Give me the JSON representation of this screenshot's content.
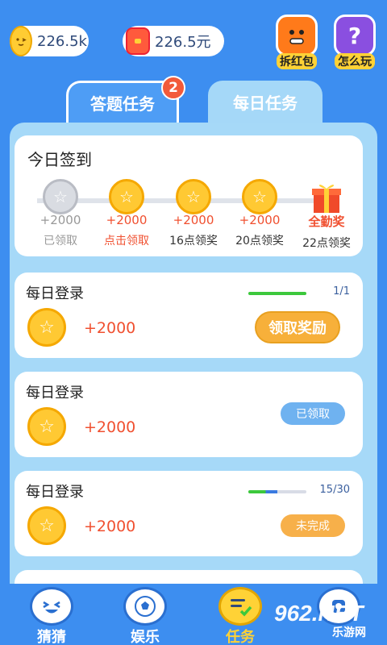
{
  "header": {
    "coins_value": "226.5k",
    "cash_value": "226.5元",
    "open_redpacket_label": "拆红包",
    "how_to_play_label": "怎么玩"
  },
  "tabs": {
    "answer_tasks_label": "答题任务",
    "answer_badge": "2",
    "daily_tasks_label": "每日任务"
  },
  "signin": {
    "title": "今日签到",
    "days": [
      {
        "amount": "+2000",
        "caption": "已领取",
        "state": "claimed"
      },
      {
        "amount": "+2000",
        "caption": "点击领取",
        "state": "claimable"
      },
      {
        "amount": "+2000",
        "caption": "16点领奖",
        "state": "pending"
      },
      {
        "amount": "+2000",
        "caption": "20点领奖",
        "state": "pending"
      },
      {
        "amount": "全勤奖",
        "caption": "22点领奖",
        "state": "gift"
      }
    ]
  },
  "tasks": [
    {
      "name": "每日登录",
      "reward": "+2000",
      "count": "1/1",
      "progress": 1.0,
      "action": "领取奖励"
    },
    {
      "name": "每日登录",
      "reward": "+2000",
      "action": "已领取"
    },
    {
      "name": "每日登录",
      "reward": "+2000",
      "count": "15/30",
      "progress": 0.5,
      "action": "未完成"
    }
  ],
  "bottom_nav": {
    "guess_label": "猜猜",
    "fun_label": "娱乐",
    "tasks_label": "任务"
  },
  "watermark": {
    "brand": "962.NET",
    "sub": "乐游网"
  },
  "colors": {
    "background": "#3d8ef0",
    "panel": "#a6d9f8",
    "reward_red": "#f05030",
    "claim_orange": "#f7b03a",
    "progress_green": "#3cc83c"
  }
}
